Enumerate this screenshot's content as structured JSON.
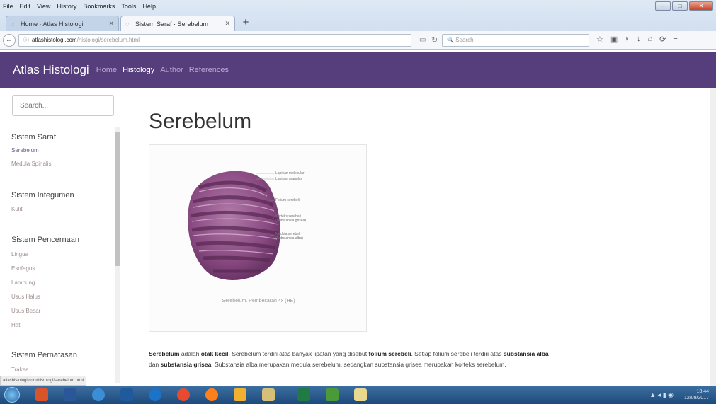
{
  "browser": {
    "menu": [
      "File",
      "Edit",
      "View",
      "History",
      "Bookmarks",
      "Tools",
      "Help"
    ],
    "tabs": [
      {
        "title": "Home · Atlas Histologi"
      },
      {
        "title": "Sistem Saraf · Serebelum"
      }
    ],
    "url_domain": "atlashistologi.com",
    "url_path": "/histologi/serebelum.html",
    "search_placeholder": "Search"
  },
  "header": {
    "brand": "Atlas Histologi",
    "nav": [
      "Home",
      "Histology",
      "Author",
      "References"
    ],
    "active_nav": "Histology"
  },
  "sidebar": {
    "search_placeholder": "Search...",
    "sections": [
      {
        "title": "Sistem Saraf",
        "items": [
          "Serebelum",
          "Medula Spinalis"
        ]
      },
      {
        "title": "Sistem Integumen",
        "items": [
          "Kulit"
        ]
      },
      {
        "title": "Sistem Pencernaan",
        "items": [
          "Lingua",
          "Esofagus",
          "Lambung",
          "Usus Halus",
          "Usus Besar",
          "Hati"
        ]
      },
      {
        "title": "Sistem Pernafasan",
        "items": [
          "Trakea"
        ]
      }
    ]
  },
  "main": {
    "title": "Serebelum",
    "figure": {
      "labels": [
        "Lapisan molekular",
        "Lapisan granular",
        "Folium serebeli",
        "Korteks serebeli (Substansia grisea)",
        "Medula serebeli (Substansia alba)"
      ],
      "caption": "Serebelum. Pembesaran 4x (HE)"
    },
    "paragraph": {
      "t1": "Serebelum",
      "t2": " adalah ",
      "t3": "otak kecil",
      "t4": ". Serebelum terdiri atas banyak lipatan yang disebut ",
      "t5": "folium serebeli",
      "t6": ". Setiap folium serebeli terdiri atas ",
      "t7": "substansia alba",
      "t8": " dan ",
      "t9": "substansia grisea",
      "t10": ". Substansia alba merupakan medula serebelum, sedangkan substansia grisea merupakan korteks serebelum."
    }
  },
  "status_bar_url": "atlashistologi.com/histologi/serebelum.html",
  "taskbar": {
    "time": "13:44",
    "date": "12/09/2017"
  },
  "colors": {
    "header_bg": "#563d7c",
    "nav_active": "#ffffff",
    "nav_inactive": "#b9a8d4"
  }
}
